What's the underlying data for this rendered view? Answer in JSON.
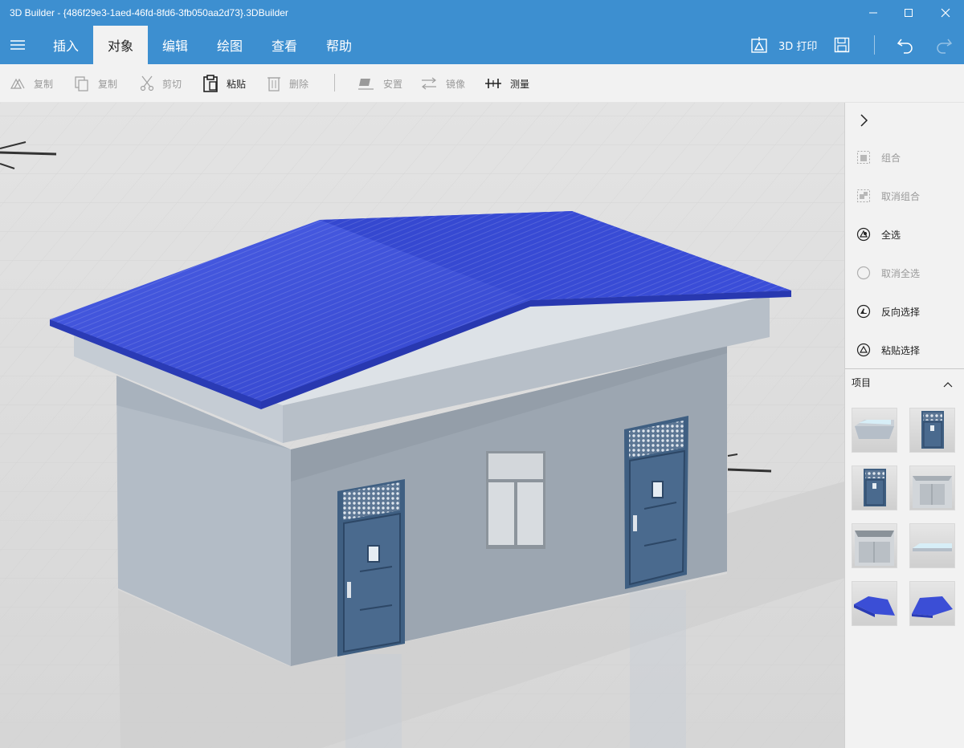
{
  "window": {
    "title": "3D Builder - {486f29e3-1aed-46fd-8fd6-3fb050aa2d73}.3DBuilder"
  },
  "menu": {
    "tabs": [
      {
        "label": "插入",
        "active": false
      },
      {
        "label": "对象",
        "active": true
      },
      {
        "label": "编辑",
        "active": false
      },
      {
        "label": "绘图",
        "active": false
      },
      {
        "label": "查看",
        "active": false
      },
      {
        "label": "帮助",
        "active": false
      }
    ],
    "print_label": "3D 打印"
  },
  "toolbar": {
    "items": [
      {
        "label": "复制",
        "icon": "duplicate-icon",
        "enabled": false
      },
      {
        "label": "复制",
        "icon": "copy-icon",
        "enabled": false
      },
      {
        "label": "剪切",
        "icon": "cut-icon",
        "enabled": false
      },
      {
        "label": "粘贴",
        "icon": "paste-icon",
        "enabled": true
      },
      {
        "label": "删除",
        "icon": "delete-icon",
        "enabled": false
      },
      {
        "label": "安置",
        "icon": "settle-icon",
        "enabled": false
      },
      {
        "label": "镜像",
        "icon": "mirror-icon",
        "enabled": false
      },
      {
        "label": "测量",
        "icon": "measure-icon",
        "enabled": true
      }
    ]
  },
  "panel": {
    "items": [
      {
        "label": "组合",
        "icon": "group-icon",
        "enabled": false
      },
      {
        "label": "取消组合",
        "icon": "ungroup-icon",
        "enabled": false
      },
      {
        "label": "全选",
        "icon": "select-all-icon",
        "enabled": true
      },
      {
        "label": "取消全选",
        "icon": "deselect-all-icon",
        "enabled": false
      },
      {
        "label": "反向选择",
        "icon": "invert-selection-icon",
        "enabled": true
      },
      {
        "label": "粘贴选择",
        "icon": "paste-selection-icon",
        "enabled": true
      }
    ],
    "items_header": "项目",
    "thumbnails": [
      "eave",
      "door",
      "door",
      "wall-front",
      "wall-back",
      "eave-flat",
      "roof-left",
      "roof-right"
    ]
  },
  "colors": {
    "accent": "#3d8fd0",
    "roof": "#3b4ed6",
    "wall": "#a7b2bd",
    "door": "#3f5f82"
  }
}
